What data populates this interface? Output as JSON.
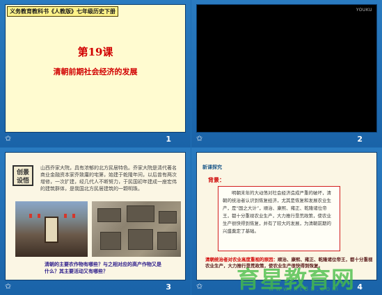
{
  "slides": [
    {
      "number": "1",
      "book_title": "义务教育教科书《人教版》七年级历史下册",
      "lesson": "第19课",
      "subtitle": "清朝前期社会经济的发展"
    },
    {
      "number": "2",
      "logo": "YOUKU"
    },
    {
      "number": "3",
      "tag": "创景设悟",
      "intro": "山西乔家大院，具有浓郁的北方民居特色。乔家大院是清代著名商业金融资本家乔致庸的宅第，始建于乾隆年间，以后曾有两次增修，一次扩建，经几代人不断努力，于民国初年建成一座宏伟的建筑群体，是我国北方民居建筑的一颗明珠。",
      "question": "清朝的主要农作物有哪些？与之相对应的高产作物又是什么？其主要活动又有哪些？"
    },
    {
      "number": "4",
      "heading": "新课探究",
      "background_label": "背景：",
      "box_text": "明朝末年的大动荡对社会经济造成严重的破坏，清朝的统治者认识到恢复经济，尤其是恢复和发展农业生产，是“国之大计”，顺治、康熙、雍正、乾隆诸位帝王，都十分重视农业生产，大力推行垦荒政策，使农业生产很快得到恢复，并有了较大的发展，为清朝前期的兴盛奠定了基础。",
      "footer_red": "清朝统治者对农业高度重视的原因：",
      "footer_text": "顺治、康熙、雍正、乾隆诸位帝王，都十分重视农业生产，大力推行垦荒政策，使农业生产很快得到恢复。"
    }
  ],
  "watermark": {
    "main": "育星教育网",
    "sub": "www.ht88.com"
  }
}
